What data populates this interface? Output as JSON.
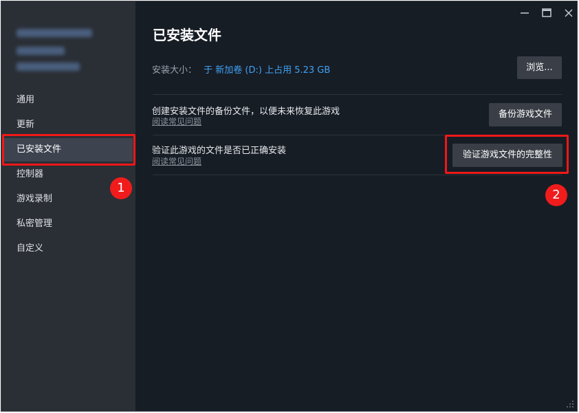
{
  "window": {
    "controls": [
      "minimize-icon",
      "maximize-icon",
      "close-icon"
    ]
  },
  "sidebar": {
    "items": [
      {
        "label": "通用"
      },
      {
        "label": "更新"
      },
      {
        "label": "已安装文件"
      },
      {
        "label": "控制器"
      },
      {
        "label": "游戏录制"
      },
      {
        "label": "私密管理"
      },
      {
        "label": "自定义"
      }
    ],
    "active_index": 2
  },
  "main": {
    "title": "已安装文件",
    "install_size_label": "安装大小：",
    "install_size_value": "于 新加卷 (D:) 上占用 5.23 GB",
    "browse_button": "浏览...",
    "backup": {
      "description": "创建安装文件的备份文件，以便未来恢复此游戏",
      "faq_link": "阅读常见问题",
      "button": "备份游戏文件"
    },
    "verify": {
      "description": "验证此游戏的文件是否已正确安装",
      "faq_link": "阅读常见问题",
      "button": "验证游戏文件的完整性"
    }
  },
  "annotations": {
    "badge_1": "1",
    "badge_2": "2"
  },
  "colors": {
    "window_bg": "#171d25",
    "sidebar_bg": "#2a2e35",
    "accent": "#3fa2f5",
    "highlight": "#f21818"
  }
}
